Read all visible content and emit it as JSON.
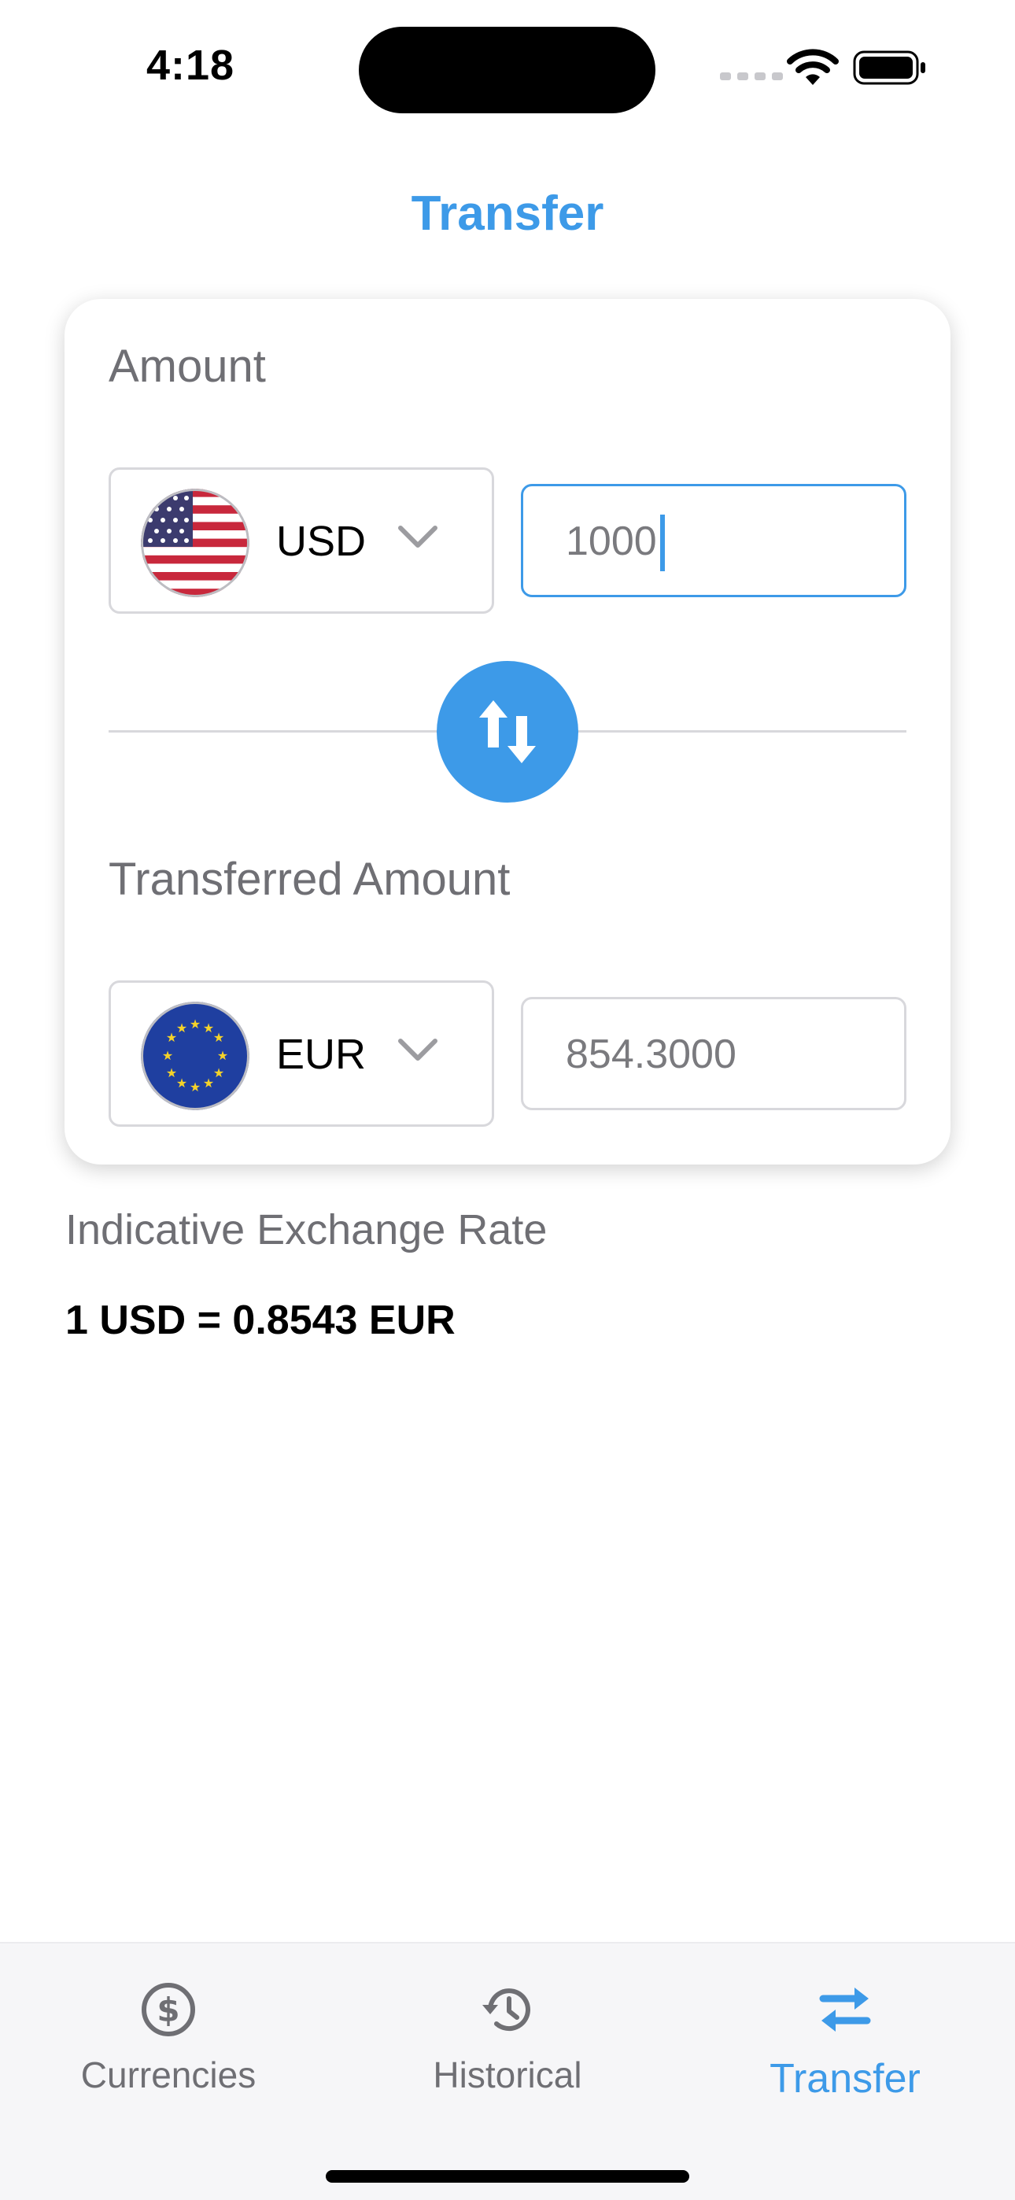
{
  "status_bar": {
    "time": "4:18"
  },
  "nav": {
    "title": "Transfer"
  },
  "amount_section": {
    "label": "Amount",
    "currency": "USD",
    "flag_icon": "us-flag-icon",
    "input_value": "1000"
  },
  "transferred_section": {
    "label": "Transferred Amount",
    "currency": "EUR",
    "flag_icon": "eu-flag-icon",
    "output_value": "854.3000"
  },
  "swap": {
    "icon": "swap-vertical-icon"
  },
  "exchange_rate": {
    "label": "Indicative Exchange Rate",
    "value": "1 USD = 0.8543 EUR"
  },
  "tab_bar": {
    "tabs": [
      {
        "label": "Currencies",
        "icon": "dollar-circle-icon",
        "active": false
      },
      {
        "label": "Historical",
        "icon": "history-icon",
        "active": false
      },
      {
        "label": "Transfer",
        "icon": "transfer-arrows-icon",
        "active": true
      }
    ]
  },
  "colors": {
    "accent": "#3d9ae8",
    "secondary_text": "#6f6f74",
    "border": "#d8d8dc",
    "tab_bar_bg": "#f6f6f8"
  }
}
